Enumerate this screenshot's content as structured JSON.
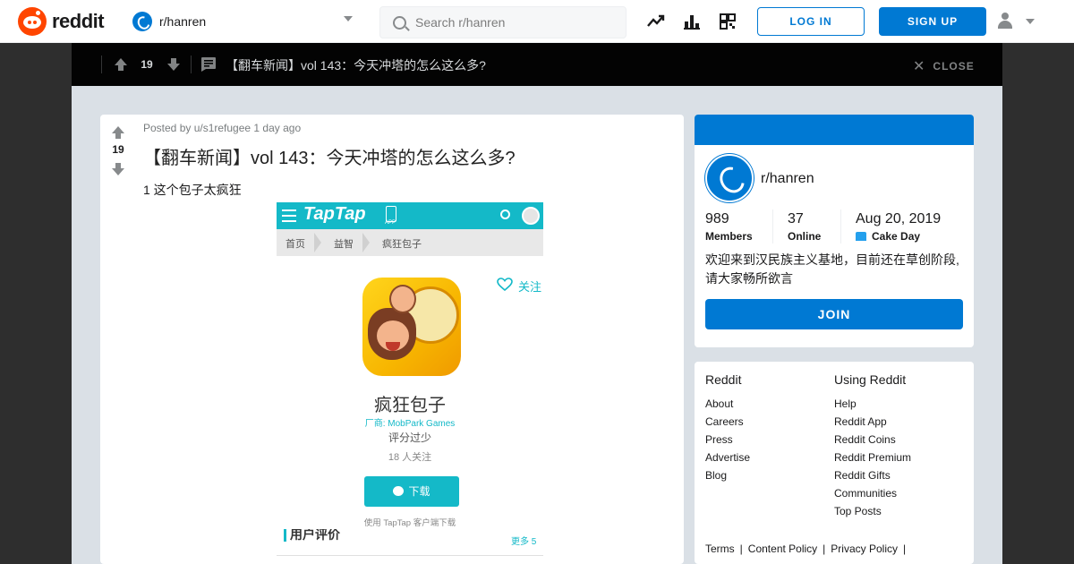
{
  "header": {
    "logo_text": "reddit",
    "community": "r/hanren",
    "search_placeholder": "Search r/hanren",
    "login_label": "LOG IN",
    "signup_label": "SIGN UP",
    "icons": [
      "trending-icon",
      "stats-icon",
      "qr-code-icon",
      "user-icon"
    ]
  },
  "overlay": {
    "score": "19",
    "title": "【翻车新闻】vol 143：今天冲塔的怎么这么多?",
    "close_label": "CLOSE"
  },
  "post": {
    "score": "19",
    "meta": "Posted by u/s1refugee 1 day ago",
    "title": "【翻车新闻】vol 143：今天冲塔的怎么这么多?",
    "body": "1 这个包子太疯狂"
  },
  "screenshot": {
    "brand": "TapTap",
    "app_label": "APP",
    "breadcrumbs": [
      "首页",
      "益智",
      "疯狂包子"
    ],
    "follow_label": "关注",
    "app_name": "疯狂包子",
    "maker": "厂商: MobPark Games",
    "rating": "评分过少",
    "followers": "18 人关注",
    "download_label": "下载",
    "via": "使用 TapTap 客户端下载",
    "reviews_heading": "用户评价",
    "more_label": "更多 5"
  },
  "sidebar": {
    "name": "r/hanren",
    "members_value": "989",
    "members_label": "Members",
    "online_value": "37",
    "online_label": "Online",
    "created_value": "Aug 20, 2019",
    "created_label": "Cake Day",
    "description": "欢迎来到汉民族主义基地，目前还在草创阶段,请大家畅所欲言",
    "join_label": "JOIN"
  },
  "footer": {
    "col1_heading": "Reddit",
    "col1_links": [
      "About",
      "Careers",
      "Press",
      "Advertise",
      "Blog"
    ],
    "col2_heading": "Using Reddit",
    "col2_links": [
      "Help",
      "Reddit App",
      "Reddit Coins",
      "Reddit Premium",
      "Reddit Gifts",
      "Communities",
      "Top Posts"
    ],
    "bottom_links": [
      "Terms",
      "Content Policy",
      "Privacy Policy"
    ]
  },
  "colors": {
    "brand_orange": "#ff4500",
    "primary_blue": "#0079d3",
    "taptap_teal": "#14b9c8"
  }
}
